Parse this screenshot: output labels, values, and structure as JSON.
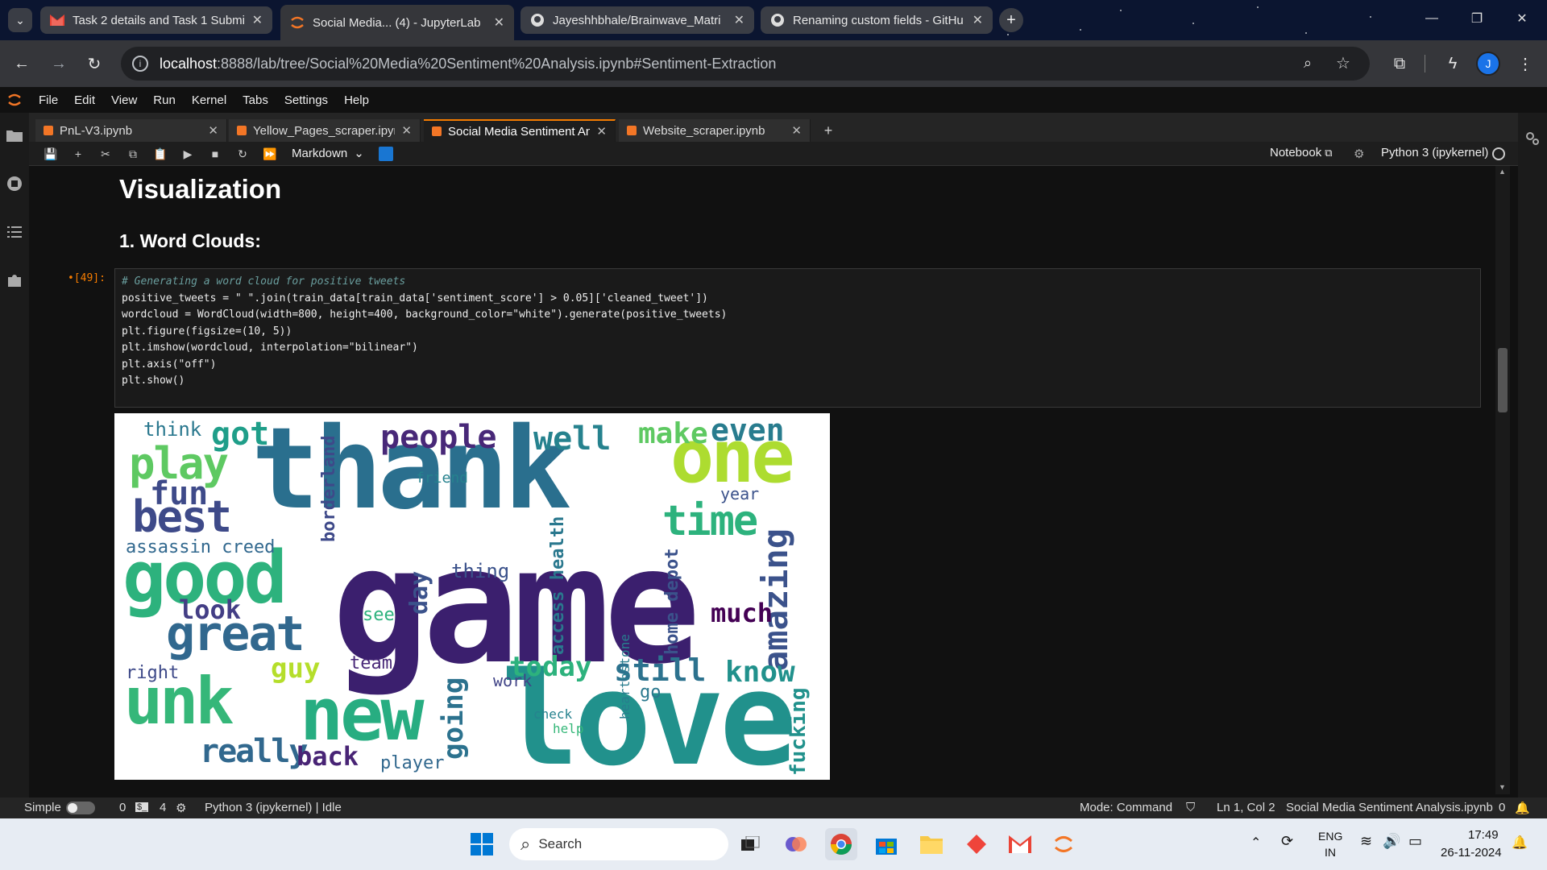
{
  "browser": {
    "tabs": [
      {
        "label": "Task 2 details and Task 1 Submi",
        "icon": "gmail-icon"
      },
      {
        "label": "Social Media... (4) - JupyterLab",
        "icon": "jupyter-icon",
        "active": true
      },
      {
        "label": "Jayeshhbhale/Brainwave_Matri",
        "icon": "github-icon"
      },
      {
        "label": "Renaming custom fields - GitHu",
        "icon": "github-icon"
      }
    ],
    "url_host": "localhost",
    "url_rest": ":8888/lab/tree/Social%20Media%20Sentiment%20Analysis.ipynb#Sentiment-Extraction",
    "profile_initial": "J"
  },
  "menubar": [
    "File",
    "Edit",
    "View",
    "Run",
    "Kernel",
    "Tabs",
    "Settings",
    "Help"
  ],
  "notebook_tabs": [
    {
      "label": "PnL-V3.ipynb"
    },
    {
      "label": "Yellow_Pages_scraper.ipynb"
    },
    {
      "label": "Social Media Sentiment Anal",
      "active": true
    },
    {
      "label": "Website_scraper.ipynb"
    }
  ],
  "toolbar": {
    "cell_type": "Markdown",
    "notebook_label": "Notebook",
    "kernel_label": "Python 3 (ipykernel)"
  },
  "content": {
    "heading1": "Visualization",
    "heading2": "1. Word Clouds:",
    "prompt": "•[49]:",
    "code_lines": [
      "# Generating a word cloud for positive tweets",
      "positive_tweets = \" \".join(train_data[train_data['sentiment_score'] > 0.05]['cleaned_tweet'])",
      "wordcloud = WordCloud(width=800, height=400, background_color=\"white\").generate(positive_tweets)",
      "",
      "plt.figure(figsize=(10, 5))",
      "plt.imshow(wordcloud, interpolation=\"bilinear\")",
      "plt.axis(\"off\")",
      "plt.show()"
    ],
    "wordcloud_words": [
      {
        "t": "game",
        "c": "#3b1f6e"
      },
      {
        "t": "thank",
        "c": "#2a6f8e"
      },
      {
        "t": "love",
        "c": "#21918c"
      },
      {
        "t": "new",
        "c": "#27ad81"
      },
      {
        "t": "good",
        "c": "#2db27d"
      },
      {
        "t": "one",
        "c": "#addc30"
      },
      {
        "t": "great",
        "c": "#31688e"
      },
      {
        "t": "unk",
        "c": "#35b779"
      },
      {
        "t": "best",
        "c": "#3e4a89"
      },
      {
        "t": "play",
        "c": "#5ec962"
      },
      {
        "t": "time",
        "c": "#2db27d"
      },
      {
        "t": "amazing",
        "c": "#3b528b"
      },
      {
        "t": "people",
        "c": "#482878"
      },
      {
        "t": "make",
        "c": "#5ec962"
      },
      {
        "t": "even",
        "c": "#287c8e"
      },
      {
        "t": "well",
        "c": "#26828e"
      },
      {
        "t": "got",
        "c": "#1f9e89"
      },
      {
        "t": "fun",
        "c": "#3e4a89"
      },
      {
        "t": "look",
        "c": "#433e85"
      },
      {
        "t": "much",
        "c": "#440154"
      },
      {
        "t": "really",
        "c": "#31688e"
      },
      {
        "t": "back",
        "c": "#482475"
      },
      {
        "t": "still",
        "c": "#2c728e"
      },
      {
        "t": "know",
        "c": "#21918c"
      },
      {
        "t": "today",
        "c": "#2db27d"
      },
      {
        "t": "guy",
        "c": "#b5de2b"
      },
      {
        "t": "going",
        "c": "#2c728e"
      },
      {
        "t": "home depot",
        "c": "#3b528b"
      },
      {
        "t": "access health",
        "c": "#2a788e"
      },
      {
        "t": "borderland",
        "c": "#3e4989"
      },
      {
        "t": "fucking",
        "c": "#21918c"
      },
      {
        "t": "day",
        "c": "#3b528b"
      },
      {
        "t": "thing",
        "c": "#3b528b"
      },
      {
        "t": "team",
        "c": "#482878"
      },
      {
        "t": "player",
        "c": "#31688e"
      },
      {
        "t": "think",
        "c": "#2a788e"
      },
      {
        "t": "assassin creed",
        "c": "#31688e"
      },
      {
        "t": "see",
        "c": "#2db27d"
      },
      {
        "t": "right",
        "c": "#3e4a89"
      },
      {
        "t": "work",
        "c": "#414487"
      },
      {
        "t": "friend",
        "c": "#26828e"
      },
      {
        "t": "year",
        "c": "#3b528b"
      },
      {
        "t": "hearthstone",
        "c": "#287d8e"
      },
      {
        "t": "check",
        "c": "#26828e"
      },
      {
        "t": "go",
        "c": "#2a788e"
      },
      {
        "t": "help",
        "c": "#35b779"
      }
    ]
  },
  "statusbar": {
    "mode_label": "Simple",
    "count_a": "0",
    "count_b": "4",
    "kernel_status": "Python 3 (ipykernel) | Idle",
    "mode": "Mode: Command",
    "cursor": "Ln 1, Col 2",
    "file": "Social Media Sentiment Analysis.ipynb",
    "notif": "0"
  },
  "taskbar": {
    "search": "Search",
    "lang1": "ENG",
    "lang2": "IN",
    "time": "17:49",
    "date": "26-11-2024"
  }
}
